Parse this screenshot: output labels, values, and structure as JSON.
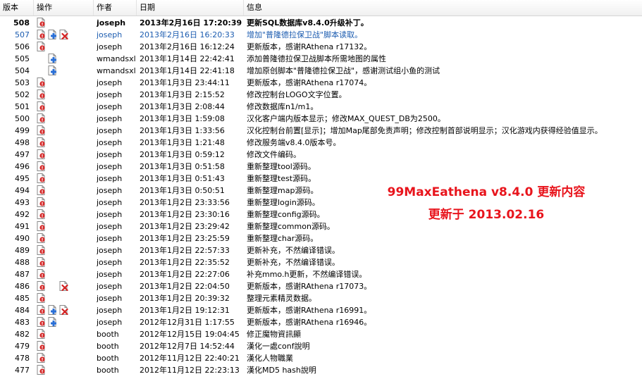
{
  "columns": {
    "revision": "版本",
    "actions": "操作",
    "author": "作者",
    "date": "日期",
    "message": "信息"
  },
  "rows": [
    {
      "rev": "508",
      "icons": [
        "file-edit-icon"
      ],
      "author": "joseph",
      "date": "2013年2月16日 17:20:39",
      "msg": "更新SQL数据库v8.4.0升级补丁。"
    },
    {
      "rev": "507",
      "icons": [
        "file-edit-icon",
        "file-add-icon",
        "file-delete-icon"
      ],
      "author": "joseph",
      "date": "2013年2月16日 16:20:33",
      "msg": "增加\"普隆德拉保卫战\"脚本读取。"
    },
    {
      "rev": "506",
      "icons": [
        "file-edit-icon"
      ],
      "author": "joseph",
      "date": "2013年2月16日 16:12:24",
      "msg": "更新版本，感谢RAthena r17132。"
    },
    {
      "rev": "505",
      "icons": [
        "",
        "file-add-icon"
      ],
      "author": "wmandsxl",
      "date": "2013年1月14日 22:42:41",
      "msg": "添加普隆德拉保卫战脚本所需地图的属性"
    },
    {
      "rev": "504",
      "icons": [
        "",
        "file-add-icon"
      ],
      "author": "wmandsxl",
      "date": "2013年1月14日 22:41:18",
      "msg": "增加原创脚本\"普隆德拉保卫战\"，感谢测试组小鱼的测试"
    },
    {
      "rev": "503",
      "icons": [
        "file-edit-icon"
      ],
      "author": "joseph",
      "date": "2013年1月3日 23:44:11",
      "msg": "更新版本，感谢RAthena r17074。"
    },
    {
      "rev": "502",
      "icons": [
        "file-edit-icon"
      ],
      "author": "joseph",
      "date": "2013年1月3日 2:15:52",
      "msg": "修改控制台LOGO文字位置。"
    },
    {
      "rev": "501",
      "icons": [
        "file-edit-icon"
      ],
      "author": "joseph",
      "date": "2013年1月3日 2:08:44",
      "msg": "修改数据库n1/m1。"
    },
    {
      "rev": "500",
      "icons": [
        "file-edit-icon"
      ],
      "author": "joseph",
      "date": "2013年1月3日 1:59:08",
      "msg": "汉化客户端内版本显示；修改MAX_QUEST_DB为2500。"
    },
    {
      "rev": "499",
      "icons": [
        "file-edit-icon"
      ],
      "author": "joseph",
      "date": "2013年1月3日 1:33:56",
      "msg": "汉化控制台前置[显示]；增加Map尾部免责声明；修改控制首部说明显示；汉化游戏内获得经验值显示。"
    },
    {
      "rev": "498",
      "icons": [
        "file-edit-icon"
      ],
      "author": "joseph",
      "date": "2013年1月3日 1:21:48",
      "msg": "修改服务端v8.4.0版本号。"
    },
    {
      "rev": "497",
      "icons": [
        "file-edit-icon"
      ],
      "author": "joseph",
      "date": "2013年1月3日 0:59:12",
      "msg": "修改文件编码。"
    },
    {
      "rev": "496",
      "icons": [
        "file-edit-icon"
      ],
      "author": "joseph",
      "date": "2013年1月3日 0:51:58",
      "msg": "重新整理tool源码。"
    },
    {
      "rev": "495",
      "icons": [
        "file-edit-icon"
      ],
      "author": "joseph",
      "date": "2013年1月3日 0:51:43",
      "msg": "重新整理test源码。"
    },
    {
      "rev": "494",
      "icons": [
        "file-edit-icon"
      ],
      "author": "joseph",
      "date": "2013年1月3日 0:50:51",
      "msg": "重新整理map源码。"
    },
    {
      "rev": "493",
      "icons": [
        "file-edit-icon"
      ],
      "author": "joseph",
      "date": "2013年1月2日 23:33:56",
      "msg": "重新整理login源码。"
    },
    {
      "rev": "492",
      "icons": [
        "file-edit-icon"
      ],
      "author": "joseph",
      "date": "2013年1月2日 23:30:16",
      "msg": "重新整理config源码。"
    },
    {
      "rev": "491",
      "icons": [
        "file-edit-icon"
      ],
      "author": "joseph",
      "date": "2013年1月2日 23:29:42",
      "msg": "重新整理common源码。"
    },
    {
      "rev": "490",
      "icons": [
        "file-edit-icon"
      ],
      "author": "joseph",
      "date": "2013年1月2日 23:25:59",
      "msg": "重新整理char源码。"
    },
    {
      "rev": "489",
      "icons": [
        "file-edit-icon"
      ],
      "author": "joseph",
      "date": "2013年1月2日 22:57:33",
      "msg": "更新补充，不然编译错误。"
    },
    {
      "rev": "488",
      "icons": [
        "file-edit-icon"
      ],
      "author": "joseph",
      "date": "2013年1月2日 22:35:52",
      "msg": "更新补充，不然编译错误。"
    },
    {
      "rev": "487",
      "icons": [
        "file-edit-icon"
      ],
      "author": "joseph",
      "date": "2013年1月2日 22:27:06",
      "msg": "补充mmo.h更新，不然编译错误。"
    },
    {
      "rev": "486",
      "icons": [
        "file-edit-icon",
        "",
        "file-delete-icon"
      ],
      "author": "joseph",
      "date": "2013年1月2日 22:04:50",
      "msg": "更新版本，感谢RAthena r17073。"
    },
    {
      "rev": "485",
      "icons": [
        "file-edit-icon"
      ],
      "author": "joseph",
      "date": "2013年1月2日 20:39:32",
      "msg": "整理元素精灵数据。"
    },
    {
      "rev": "484",
      "icons": [
        "file-edit-icon",
        "file-add-icon",
        "file-delete-icon"
      ],
      "author": "joseph",
      "date": "2013年1月2日 19:12:31",
      "msg": "更新版本，感谢RAthena r16991。"
    },
    {
      "rev": "483",
      "icons": [
        "file-edit-icon",
        "file-add-icon"
      ],
      "author": "joseph",
      "date": "2012年12月31日 1:17:55",
      "msg": "更新版本，感谢RAthena r16946。"
    },
    {
      "rev": "482",
      "icons": [
        "file-edit-icon"
      ],
      "author": "booth",
      "date": "2012年12月15日 19:04:45",
      "msg": "修正魔物資訊顯"
    },
    {
      "rev": "479",
      "icons": [
        "file-edit-icon"
      ],
      "author": "booth",
      "date": "2012年12月7日 14:52:44",
      "msg": "漢化一處conf說明"
    },
    {
      "rev": "478",
      "icons": [
        "file-edit-icon"
      ],
      "author": "booth",
      "date": "2012年11月12日 22:40:21",
      "msg": "漢化人物職業"
    },
    {
      "rev": "477",
      "icons": [
        "file-edit-icon"
      ],
      "author": "booth",
      "date": "2012年11月12日 22:23:13",
      "msg": "漢化MD5 hash說明"
    }
  ],
  "overlay": {
    "line1": "99MaxEathena v8.4.0 更新内容",
    "line2": "更新于 2013.02.16"
  },
  "colors": {
    "highlight": "#1c5cb0",
    "overlay": "#e8141c"
  }
}
